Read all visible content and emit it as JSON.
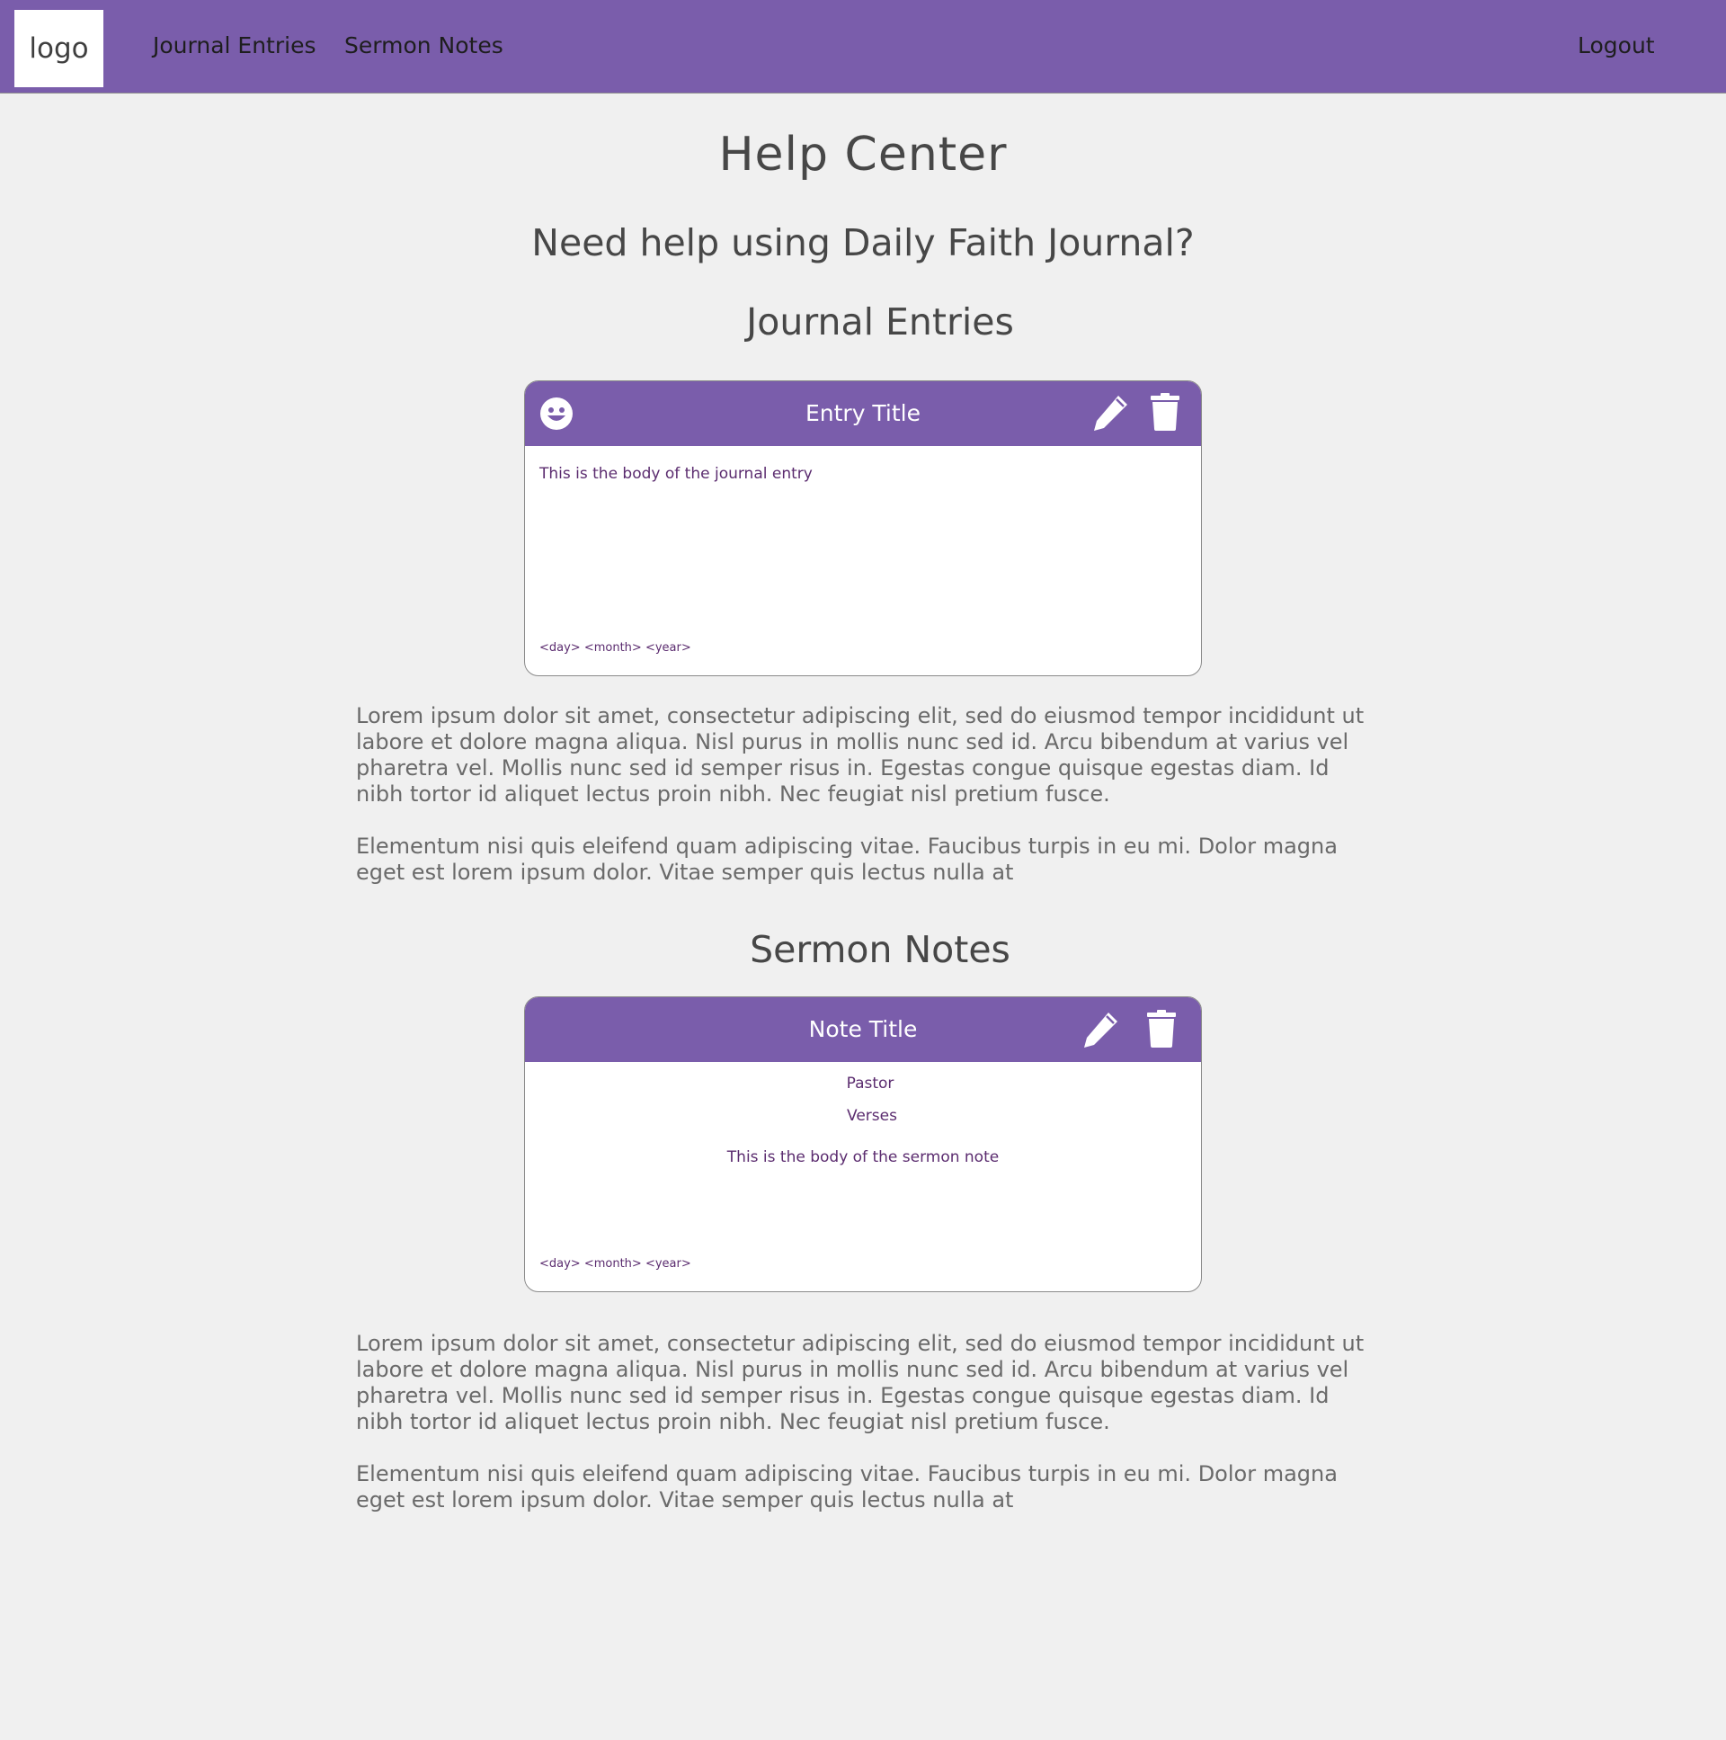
{
  "nav": {
    "logo": "logo",
    "links": [
      "Journal Entries",
      "Sermon Notes"
    ],
    "logout": "Logout"
  },
  "page": {
    "title": "Help Center",
    "subtitle": "Need help using Daily Faith Journal?"
  },
  "journal_section": {
    "heading": "Journal Entries",
    "card": {
      "title": "Entry Title",
      "body": "This is the body of the journal entry",
      "date": "<day> <month> <year>",
      "icons": [
        "smile-icon",
        "pencil-icon",
        "trash-icon"
      ]
    },
    "paragraphs": [
      "Lorem ipsum dolor sit amet, consectetur adipiscing elit, sed do eiusmod tempor incididunt ut labore et dolore magna aliqua. Nisl purus in mollis nunc sed id. Arcu bibendum at varius vel pharetra vel. Mollis nunc sed id semper risus in. Egestas congue quisque egestas diam. Id nibh tortor id aliquet lectus proin nibh. Nec feugiat nisl pretium fusce.",
      "Elementum nisi quis eleifend quam adipiscing vitae. Faucibus turpis in eu mi. Dolor magna eget est lorem ipsum dolor. Vitae semper quis lectus nulla at"
    ]
  },
  "sermon_section": {
    "heading": "Sermon Notes",
    "card": {
      "title": "Note Title",
      "pastor": "Pastor",
      "verses": "Verses",
      "body": "This is the body of the sermon note",
      "date": "<day> <month> <year>",
      "icons": [
        "pencil-icon",
        "trash-icon"
      ]
    },
    "paragraphs": [
      "Lorem ipsum dolor sit amet, consectetur adipiscing elit, sed do eiusmod tempor incididunt ut labore et dolore magna aliqua. Nisl purus in mollis nunc sed id. Arcu bibendum at varius vel pharetra vel. Mollis nunc sed id semper risus in. Egestas congue quisque egestas diam. Id nibh tortor id aliquet lectus proin nibh. Nec feugiat nisl pretium fusce.",
      "Elementum nisi quis eleifend quam adipiscing vitae. Faucibus turpis in eu mi. Dolor magna eget est lorem ipsum dolor. Vitae semper quis lectus nulla at"
    ]
  },
  "colors": {
    "accent": "#7a5dab",
    "background": "#f0f0f0",
    "card_text": "#5b2c6f"
  }
}
